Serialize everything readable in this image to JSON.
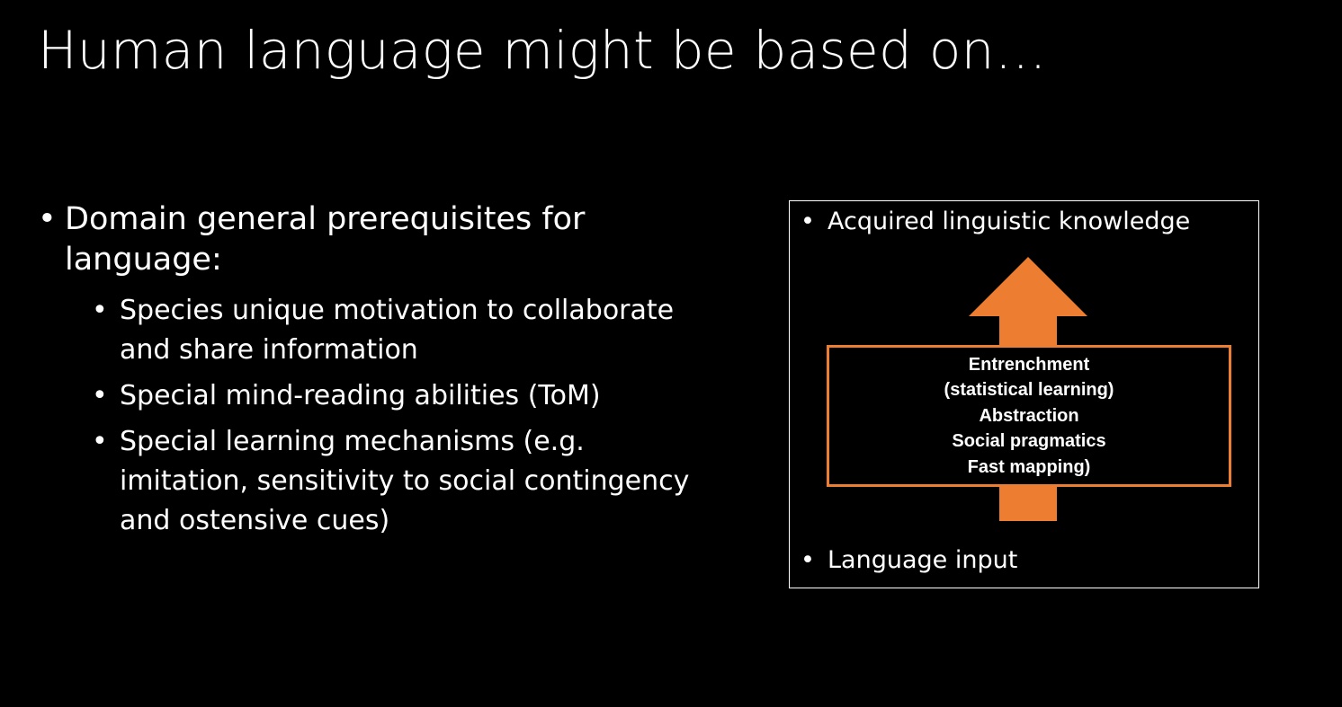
{
  "slide": {
    "title": "Human language might be based on…",
    "bullet_glyph": "•",
    "main_point": {
      "text": "Domain general prerequisites for language:",
      "subpoints": [
        "Species unique motivation to collaborate and share information",
        "Special mind-reading abilities (ToM)",
        "Special learning mechanisms (e.g. imitation, sensitivity to social contingency and ostensive cues)"
      ]
    }
  },
  "diagram": {
    "top_label": "Acquired linguistic knowledge",
    "bottom_label": "Language input",
    "mechanisms": [
      "Entrenchment",
      "(statistical learning)",
      "Abstraction",
      "Social pragmatics",
      "Fast mapping)"
    ],
    "arrow_direction": "up",
    "colors": {
      "arrow": "#ed7d31",
      "mechanism_border": "#ed7d31",
      "frame": "#ffffff",
      "background": "#000000",
      "text": "#ffffff"
    }
  }
}
